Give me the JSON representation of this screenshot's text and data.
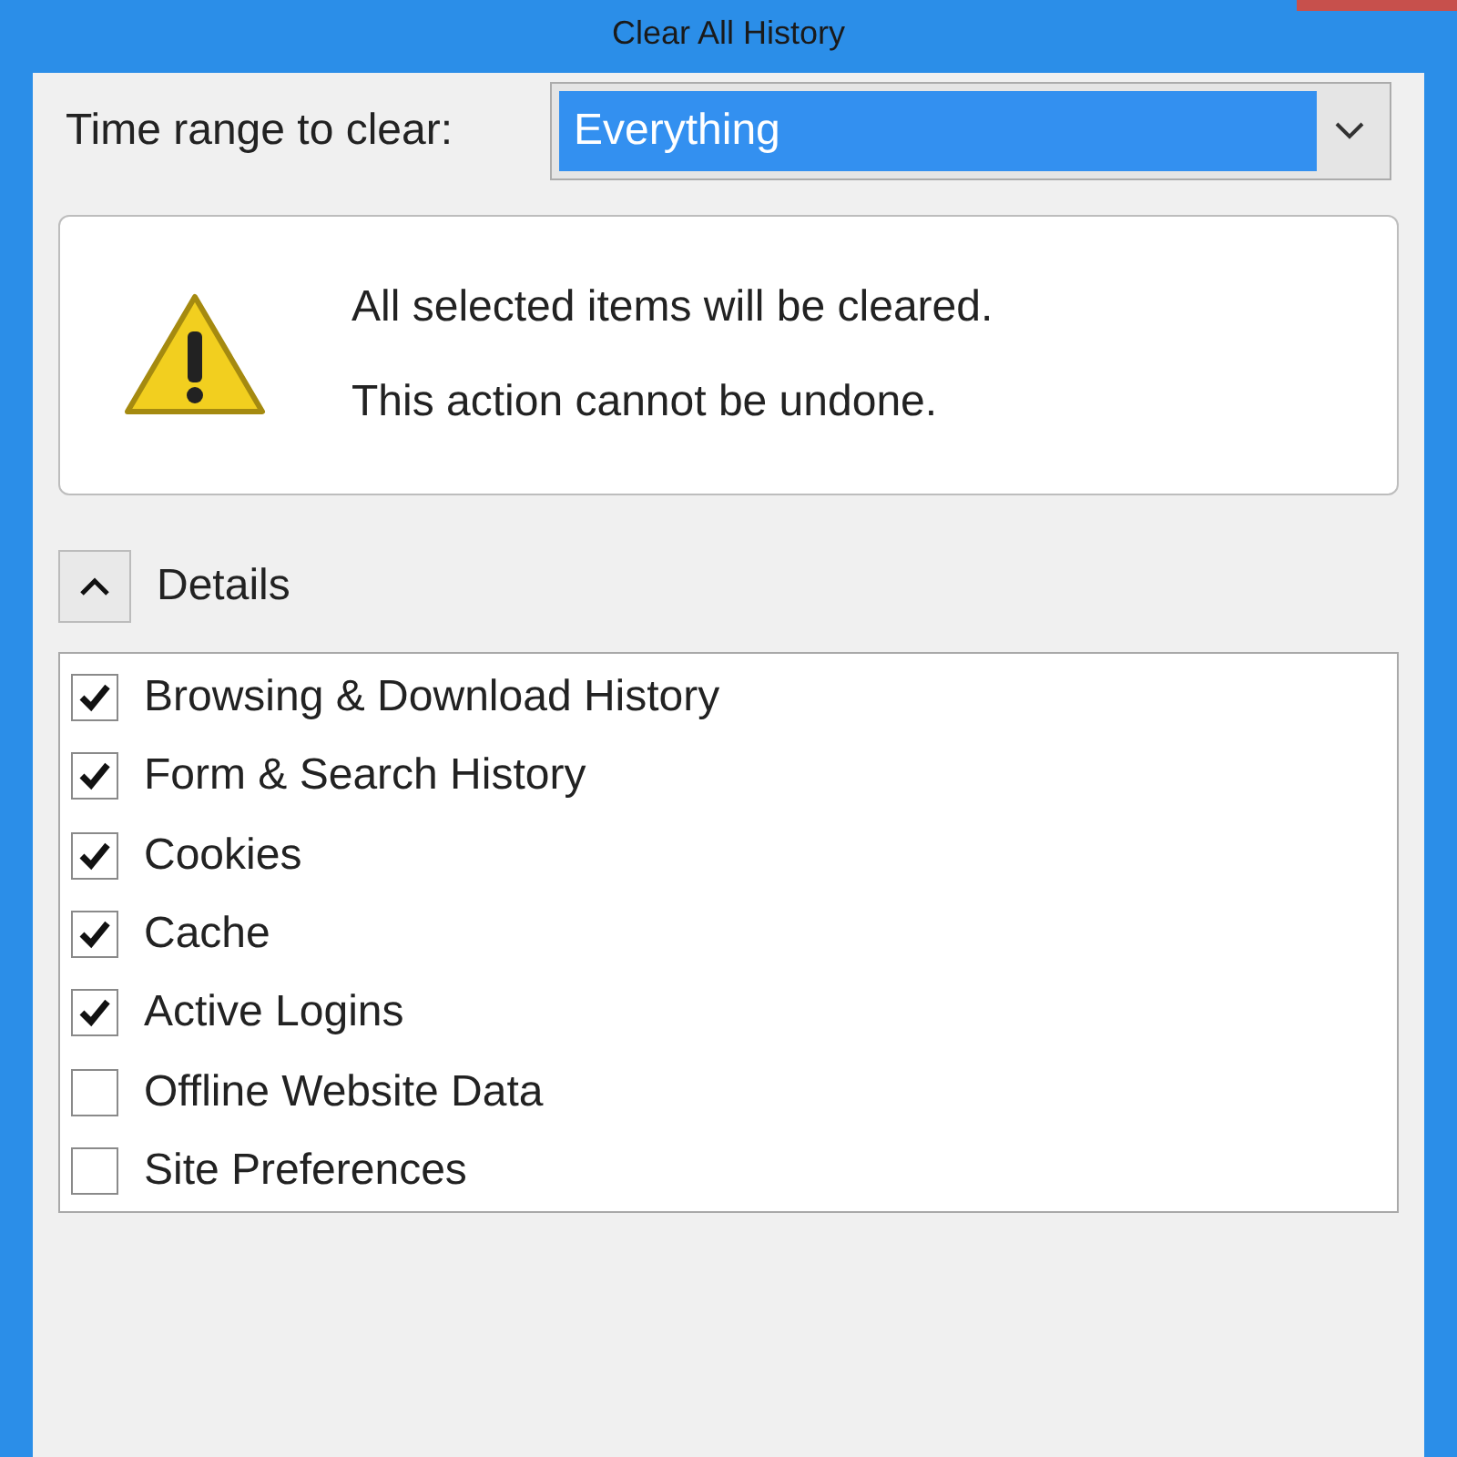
{
  "window": {
    "title": "Clear All History"
  },
  "time_range": {
    "label": "Time range to clear:",
    "value": "Everything"
  },
  "warning": {
    "lines": [
      "All selected items will be cleared.",
      "This action cannot be undone."
    ]
  },
  "details": {
    "label": "Details",
    "expanded": true
  },
  "items": [
    {
      "label": "Browsing & Download History",
      "checked": true
    },
    {
      "label": "Form & Search History",
      "checked": true
    },
    {
      "label": "Cookies",
      "checked": true
    },
    {
      "label": "Cache",
      "checked": true
    },
    {
      "label": "Active Logins",
      "checked": true
    },
    {
      "label": "Offline Website Data",
      "checked": false
    },
    {
      "label": "Site Preferences",
      "checked": false
    }
  ]
}
